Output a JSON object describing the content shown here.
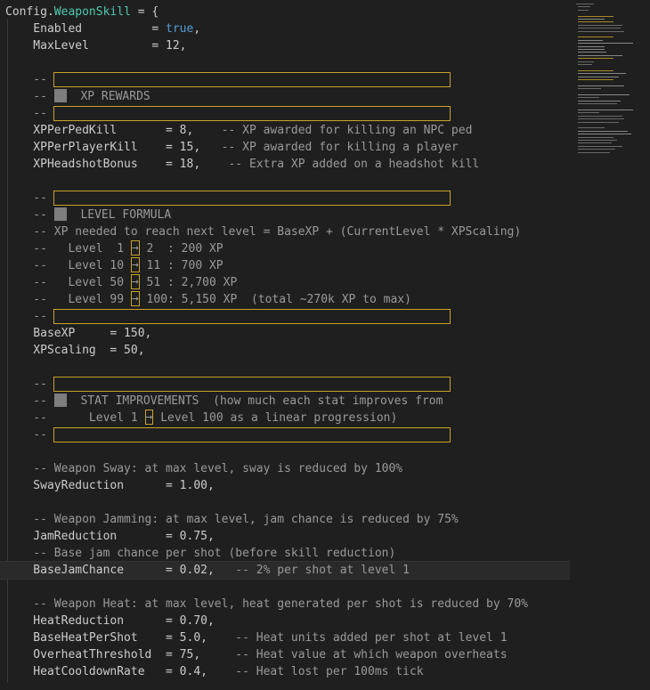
{
  "code": {
    "l01_obj": "Config",
    "l01_prop": "WeaponSkill",
    "l01_rest": " = {",
    "l02": "    Enabled          = ",
    "l02_val": "true",
    "l02_end": ",",
    "l03": "    MaxLevel         = 12,",
    "l05": "    --",
    "l06_a": "    -- ",
    "l06_b": "  XP REWARDS",
    "l07": "    --",
    "l08": "    XPPerPedKill       = 8,",
    "l08_c": "    -- XP awarded for killing an NPC ped",
    "l09": "    XPPerPlayerKill    = 15,",
    "l09_c": "   -- XP awarded for killing a player",
    "l10": "    XPHeadshotBonus    = 18,",
    "l10_c": "    -- Extra XP added on a headshot kill",
    "l12": "    --",
    "l13_a": "    -- ",
    "l13_b": "  LEVEL FORMULA",
    "l14": "    -- XP needed to reach next level = BaseXP + (CurrentLevel * XPScaling)",
    "l15_a": "    --   Level  1 ",
    "l15_b": " 2  : 200 XP",
    "l16_a": "    --   Level 10 ",
    "l16_b": " 11 : 700 XP",
    "l17_a": "    --   Level 50 ",
    "l17_b": " 51 : 2,700 XP",
    "l18_a": "    --   Level 99 ",
    "l18_b": " 100: 5,150 XP  (total ~270k XP to max)",
    "l19": "    --",
    "l20": "    BaseXP     = 150,",
    "l21": "    XPScaling  = 50,",
    "l23": "    --",
    "l24_a": "    -- ",
    "l24_b": "  STAT IMPROVEMENTS  (how much each stat improves from",
    "l25_a": "    --      Level 1 ",
    "l25_b": " Level 100 as a linear progression)",
    "l26": "    --",
    "l28": "    -- Weapon Sway: at max level, sway is reduced by 100%",
    "l29": "    SwayReduction      = 1.00,",
    "l31": "    -- Weapon Jamming: at max level, jam chance is reduced by 75%",
    "l32": "    JamReduction       = 0.75,",
    "l33": "    -- Base jam chance per shot (before skill reduction)",
    "l34": "    BaseJamChance      = 0.02,",
    "l34_c": "   -- 2% per shot at level 1",
    "l36": "    -- Weapon Heat: at max level, heat generated per shot is reduced by 70%",
    "l37": "    HeatReduction      = 0.70,",
    "l38": "    BaseHeatPerShot    = 5.0,",
    "l38_c": "    -- Heat units added per shot at level 1",
    "l39": "    OverheatThreshold  = 75,",
    "l39_c": "     -- Heat value at which weapon overheats",
    "l40": "    HeatCooldownRate   = 0.4,",
    "l40_c": "    -- Heat lost per 100ms tick",
    "arrow": "→"
  },
  "colors": {
    "background": "#1f1f1f",
    "property": "#4ec9b0",
    "boolean": "#569cd6",
    "comment": "#9a9a9a",
    "highlight_border": "#c9a32a"
  }
}
